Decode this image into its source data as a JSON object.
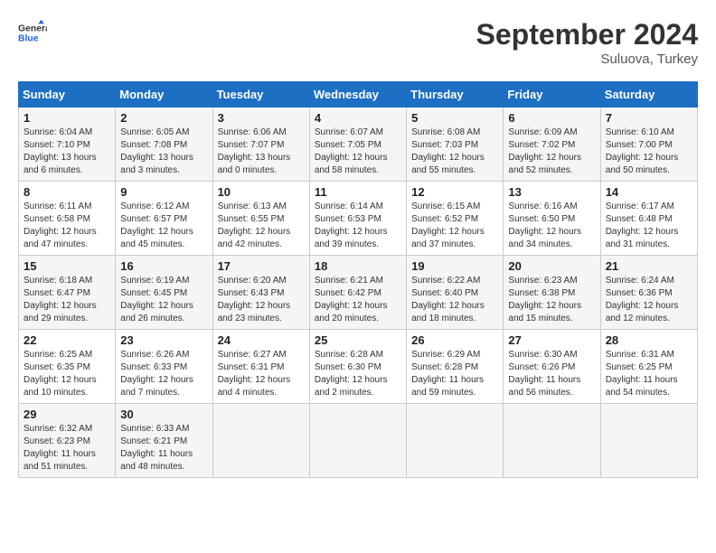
{
  "header": {
    "logo_line1": "General",
    "logo_line2": "Blue",
    "month": "September 2024",
    "location": "Suluova, Turkey"
  },
  "days_of_week": [
    "Sunday",
    "Monday",
    "Tuesday",
    "Wednesday",
    "Thursday",
    "Friday",
    "Saturday"
  ],
  "weeks": [
    [
      {
        "day": "1",
        "sunrise": "6:04 AM",
        "sunset": "7:10 PM",
        "daylight": "13 hours and 6 minutes."
      },
      {
        "day": "2",
        "sunrise": "6:05 AM",
        "sunset": "7:08 PM",
        "daylight": "13 hours and 3 minutes."
      },
      {
        "day": "3",
        "sunrise": "6:06 AM",
        "sunset": "7:07 PM",
        "daylight": "13 hours and 0 minutes."
      },
      {
        "day": "4",
        "sunrise": "6:07 AM",
        "sunset": "7:05 PM",
        "daylight": "12 hours and 58 minutes."
      },
      {
        "day": "5",
        "sunrise": "6:08 AM",
        "sunset": "7:03 PM",
        "daylight": "12 hours and 55 minutes."
      },
      {
        "day": "6",
        "sunrise": "6:09 AM",
        "sunset": "7:02 PM",
        "daylight": "12 hours and 52 minutes."
      },
      {
        "day": "7",
        "sunrise": "6:10 AM",
        "sunset": "7:00 PM",
        "daylight": "12 hours and 50 minutes."
      }
    ],
    [
      {
        "day": "8",
        "sunrise": "6:11 AM",
        "sunset": "6:58 PM",
        "daylight": "12 hours and 47 minutes."
      },
      {
        "day": "9",
        "sunrise": "6:12 AM",
        "sunset": "6:57 PM",
        "daylight": "12 hours and 45 minutes."
      },
      {
        "day": "10",
        "sunrise": "6:13 AM",
        "sunset": "6:55 PM",
        "daylight": "12 hours and 42 minutes."
      },
      {
        "day": "11",
        "sunrise": "6:14 AM",
        "sunset": "6:53 PM",
        "daylight": "12 hours and 39 minutes."
      },
      {
        "day": "12",
        "sunrise": "6:15 AM",
        "sunset": "6:52 PM",
        "daylight": "12 hours and 37 minutes."
      },
      {
        "day": "13",
        "sunrise": "6:16 AM",
        "sunset": "6:50 PM",
        "daylight": "12 hours and 34 minutes."
      },
      {
        "day": "14",
        "sunrise": "6:17 AM",
        "sunset": "6:48 PM",
        "daylight": "12 hours and 31 minutes."
      }
    ],
    [
      {
        "day": "15",
        "sunrise": "6:18 AM",
        "sunset": "6:47 PM",
        "daylight": "12 hours and 29 minutes."
      },
      {
        "day": "16",
        "sunrise": "6:19 AM",
        "sunset": "6:45 PM",
        "daylight": "12 hours and 26 minutes."
      },
      {
        "day": "17",
        "sunrise": "6:20 AM",
        "sunset": "6:43 PM",
        "daylight": "12 hours and 23 minutes."
      },
      {
        "day": "18",
        "sunrise": "6:21 AM",
        "sunset": "6:42 PM",
        "daylight": "12 hours and 20 minutes."
      },
      {
        "day": "19",
        "sunrise": "6:22 AM",
        "sunset": "6:40 PM",
        "daylight": "12 hours and 18 minutes."
      },
      {
        "day": "20",
        "sunrise": "6:23 AM",
        "sunset": "6:38 PM",
        "daylight": "12 hours and 15 minutes."
      },
      {
        "day": "21",
        "sunrise": "6:24 AM",
        "sunset": "6:36 PM",
        "daylight": "12 hours and 12 minutes."
      }
    ],
    [
      {
        "day": "22",
        "sunrise": "6:25 AM",
        "sunset": "6:35 PM",
        "daylight": "12 hours and 10 minutes."
      },
      {
        "day": "23",
        "sunrise": "6:26 AM",
        "sunset": "6:33 PM",
        "daylight": "12 hours and 7 minutes."
      },
      {
        "day": "24",
        "sunrise": "6:27 AM",
        "sunset": "6:31 PM",
        "daylight": "12 hours and 4 minutes."
      },
      {
        "day": "25",
        "sunrise": "6:28 AM",
        "sunset": "6:30 PM",
        "daylight": "12 hours and 2 minutes."
      },
      {
        "day": "26",
        "sunrise": "6:29 AM",
        "sunset": "6:28 PM",
        "daylight": "11 hours and 59 minutes."
      },
      {
        "day": "27",
        "sunrise": "6:30 AM",
        "sunset": "6:26 PM",
        "daylight": "11 hours and 56 minutes."
      },
      {
        "day": "28",
        "sunrise": "6:31 AM",
        "sunset": "6:25 PM",
        "daylight": "11 hours and 54 minutes."
      }
    ],
    [
      {
        "day": "29",
        "sunrise": "6:32 AM",
        "sunset": "6:23 PM",
        "daylight": "11 hours and 51 minutes."
      },
      {
        "day": "30",
        "sunrise": "6:33 AM",
        "sunset": "6:21 PM",
        "daylight": "11 hours and 48 minutes."
      },
      null,
      null,
      null,
      null,
      null
    ]
  ]
}
